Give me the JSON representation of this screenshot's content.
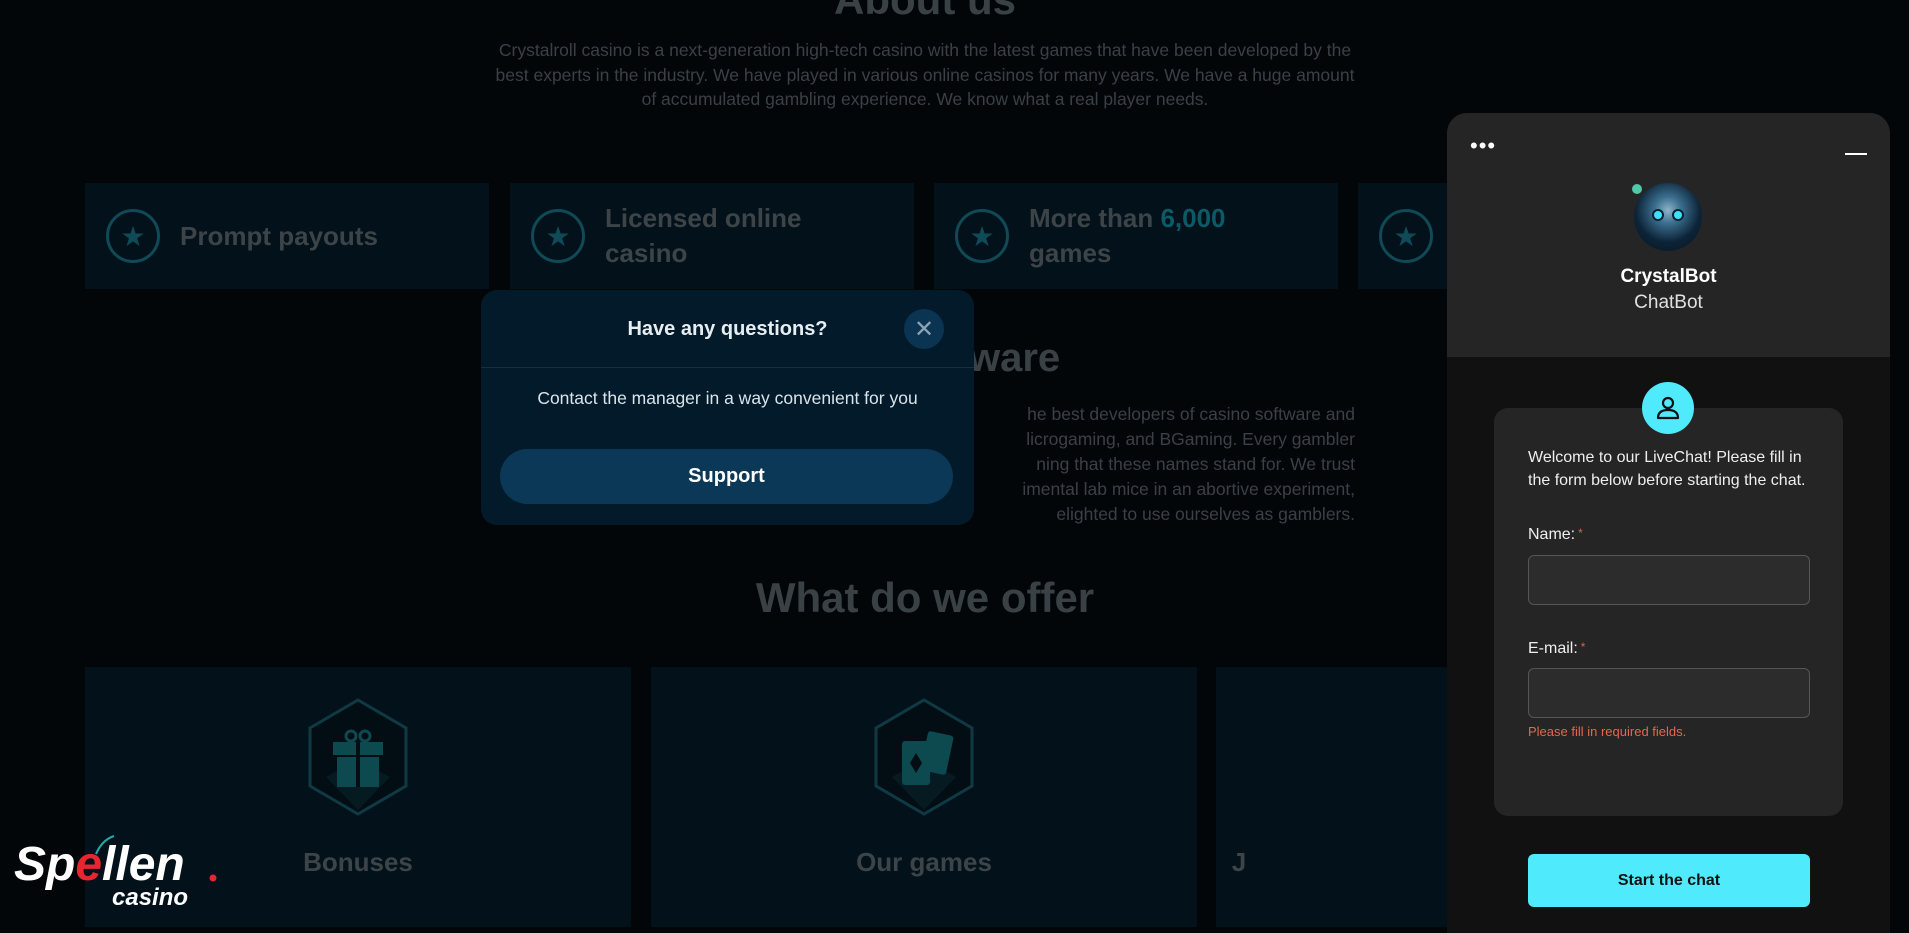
{
  "about": {
    "title": "About us",
    "paragraph": "Crystalroll casino is a next-generation high-tech casino with the latest games that have been developed by the best experts in the industry. We have played in various online casinos for many years. We have a huge amount of accumulated gambling experience. We know what a real player needs."
  },
  "features": [
    {
      "label": "Prompt payouts",
      "icon": "star-icon"
    },
    {
      "label": "Licensed online casino",
      "icon": "star-icon"
    },
    {
      "label_before": "More than ",
      "highlight": "6,000",
      "label_after": " games",
      "icon": "star-icon"
    },
    {
      "label": "",
      "icon": "star-icon"
    }
  ],
  "software": {
    "title_visible": "ware",
    "lines": [
      "he best developers of casino software and",
      "licrogaming, and BGaming. Every gambler",
      "ning that these names stand for. We trust",
      "imental lab mice in an abortive experiment,",
      "elighted to use ourselves as gamblers."
    ]
  },
  "offer": {
    "title": "What do we offer",
    "cards": [
      {
        "label": "Bonuses",
        "icon": "gift-icon"
      },
      {
        "label": "Our games",
        "icon": "cards-icon"
      },
      {
        "label": "J",
        "icon": "hexagon-icon"
      }
    ]
  },
  "modal": {
    "title": "Have any questions?",
    "text": "Contact the manager in a way convenient for you",
    "support_label": "Support",
    "close_icon": "close-icon"
  },
  "chat": {
    "menu_icon": "ellipsis-icon",
    "minimize_icon": "minimize-icon",
    "bot_name": "CrystalBot",
    "bot_role": "ChatBot",
    "welcome": "Welcome to our LiveChat! Please fill in the form below before starting the chat.",
    "name_label": "Name:",
    "name_value": "",
    "error": "Please fill in required fields.",
    "email_label": "E-mail:",
    "email_value": "",
    "required_mark": "*",
    "start_label": "Start the chat",
    "accent": "#4feafc"
  },
  "logo": {
    "text": "Spellen",
    "sub": "casino"
  }
}
